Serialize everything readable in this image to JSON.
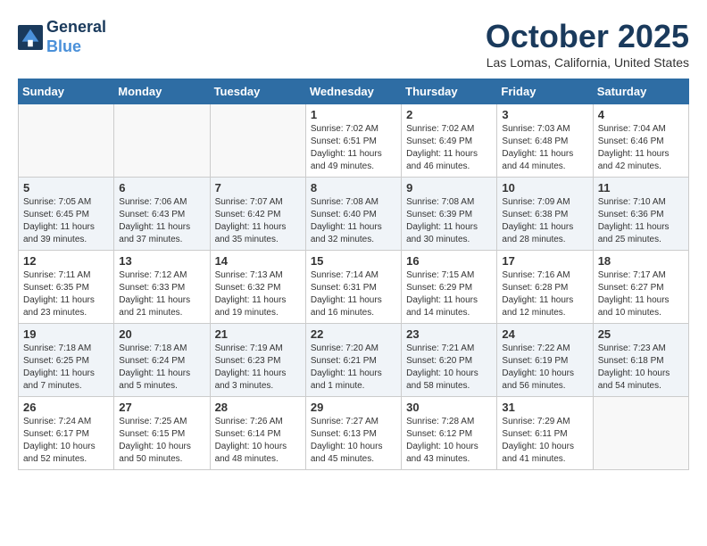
{
  "header": {
    "logo_line1": "General",
    "logo_line2": "Blue",
    "month": "October 2025",
    "location": "Las Lomas, California, United States"
  },
  "weekdays": [
    "Sunday",
    "Monday",
    "Tuesday",
    "Wednesday",
    "Thursday",
    "Friday",
    "Saturday"
  ],
  "weeks": [
    [
      {
        "day": "",
        "info": ""
      },
      {
        "day": "",
        "info": ""
      },
      {
        "day": "",
        "info": ""
      },
      {
        "day": "1",
        "info": "Sunrise: 7:02 AM\nSunset: 6:51 PM\nDaylight: 11 hours\nand 49 minutes."
      },
      {
        "day": "2",
        "info": "Sunrise: 7:02 AM\nSunset: 6:49 PM\nDaylight: 11 hours\nand 46 minutes."
      },
      {
        "day": "3",
        "info": "Sunrise: 7:03 AM\nSunset: 6:48 PM\nDaylight: 11 hours\nand 44 minutes."
      },
      {
        "day": "4",
        "info": "Sunrise: 7:04 AM\nSunset: 6:46 PM\nDaylight: 11 hours\nand 42 minutes."
      }
    ],
    [
      {
        "day": "5",
        "info": "Sunrise: 7:05 AM\nSunset: 6:45 PM\nDaylight: 11 hours\nand 39 minutes."
      },
      {
        "day": "6",
        "info": "Sunrise: 7:06 AM\nSunset: 6:43 PM\nDaylight: 11 hours\nand 37 minutes."
      },
      {
        "day": "7",
        "info": "Sunrise: 7:07 AM\nSunset: 6:42 PM\nDaylight: 11 hours\nand 35 minutes."
      },
      {
        "day": "8",
        "info": "Sunrise: 7:08 AM\nSunset: 6:40 PM\nDaylight: 11 hours\nand 32 minutes."
      },
      {
        "day": "9",
        "info": "Sunrise: 7:08 AM\nSunset: 6:39 PM\nDaylight: 11 hours\nand 30 minutes."
      },
      {
        "day": "10",
        "info": "Sunrise: 7:09 AM\nSunset: 6:38 PM\nDaylight: 11 hours\nand 28 minutes."
      },
      {
        "day": "11",
        "info": "Sunrise: 7:10 AM\nSunset: 6:36 PM\nDaylight: 11 hours\nand 25 minutes."
      }
    ],
    [
      {
        "day": "12",
        "info": "Sunrise: 7:11 AM\nSunset: 6:35 PM\nDaylight: 11 hours\nand 23 minutes."
      },
      {
        "day": "13",
        "info": "Sunrise: 7:12 AM\nSunset: 6:33 PM\nDaylight: 11 hours\nand 21 minutes."
      },
      {
        "day": "14",
        "info": "Sunrise: 7:13 AM\nSunset: 6:32 PM\nDaylight: 11 hours\nand 19 minutes."
      },
      {
        "day": "15",
        "info": "Sunrise: 7:14 AM\nSunset: 6:31 PM\nDaylight: 11 hours\nand 16 minutes."
      },
      {
        "day": "16",
        "info": "Sunrise: 7:15 AM\nSunset: 6:29 PM\nDaylight: 11 hours\nand 14 minutes."
      },
      {
        "day": "17",
        "info": "Sunrise: 7:16 AM\nSunset: 6:28 PM\nDaylight: 11 hours\nand 12 minutes."
      },
      {
        "day": "18",
        "info": "Sunrise: 7:17 AM\nSunset: 6:27 PM\nDaylight: 11 hours\nand 10 minutes."
      }
    ],
    [
      {
        "day": "19",
        "info": "Sunrise: 7:18 AM\nSunset: 6:25 PM\nDaylight: 11 hours\nand 7 minutes."
      },
      {
        "day": "20",
        "info": "Sunrise: 7:18 AM\nSunset: 6:24 PM\nDaylight: 11 hours\nand 5 minutes."
      },
      {
        "day": "21",
        "info": "Sunrise: 7:19 AM\nSunset: 6:23 PM\nDaylight: 11 hours\nand 3 minutes."
      },
      {
        "day": "22",
        "info": "Sunrise: 7:20 AM\nSunset: 6:21 PM\nDaylight: 11 hours\nand 1 minute."
      },
      {
        "day": "23",
        "info": "Sunrise: 7:21 AM\nSunset: 6:20 PM\nDaylight: 10 hours\nand 58 minutes."
      },
      {
        "day": "24",
        "info": "Sunrise: 7:22 AM\nSunset: 6:19 PM\nDaylight: 10 hours\nand 56 minutes."
      },
      {
        "day": "25",
        "info": "Sunrise: 7:23 AM\nSunset: 6:18 PM\nDaylight: 10 hours\nand 54 minutes."
      }
    ],
    [
      {
        "day": "26",
        "info": "Sunrise: 7:24 AM\nSunset: 6:17 PM\nDaylight: 10 hours\nand 52 minutes."
      },
      {
        "day": "27",
        "info": "Sunrise: 7:25 AM\nSunset: 6:15 PM\nDaylight: 10 hours\nand 50 minutes."
      },
      {
        "day": "28",
        "info": "Sunrise: 7:26 AM\nSunset: 6:14 PM\nDaylight: 10 hours\nand 48 minutes."
      },
      {
        "day": "29",
        "info": "Sunrise: 7:27 AM\nSunset: 6:13 PM\nDaylight: 10 hours\nand 45 minutes."
      },
      {
        "day": "30",
        "info": "Sunrise: 7:28 AM\nSunset: 6:12 PM\nDaylight: 10 hours\nand 43 minutes."
      },
      {
        "day": "31",
        "info": "Sunrise: 7:29 AM\nSunset: 6:11 PM\nDaylight: 10 hours\nand 41 minutes."
      },
      {
        "day": "",
        "info": ""
      }
    ]
  ]
}
